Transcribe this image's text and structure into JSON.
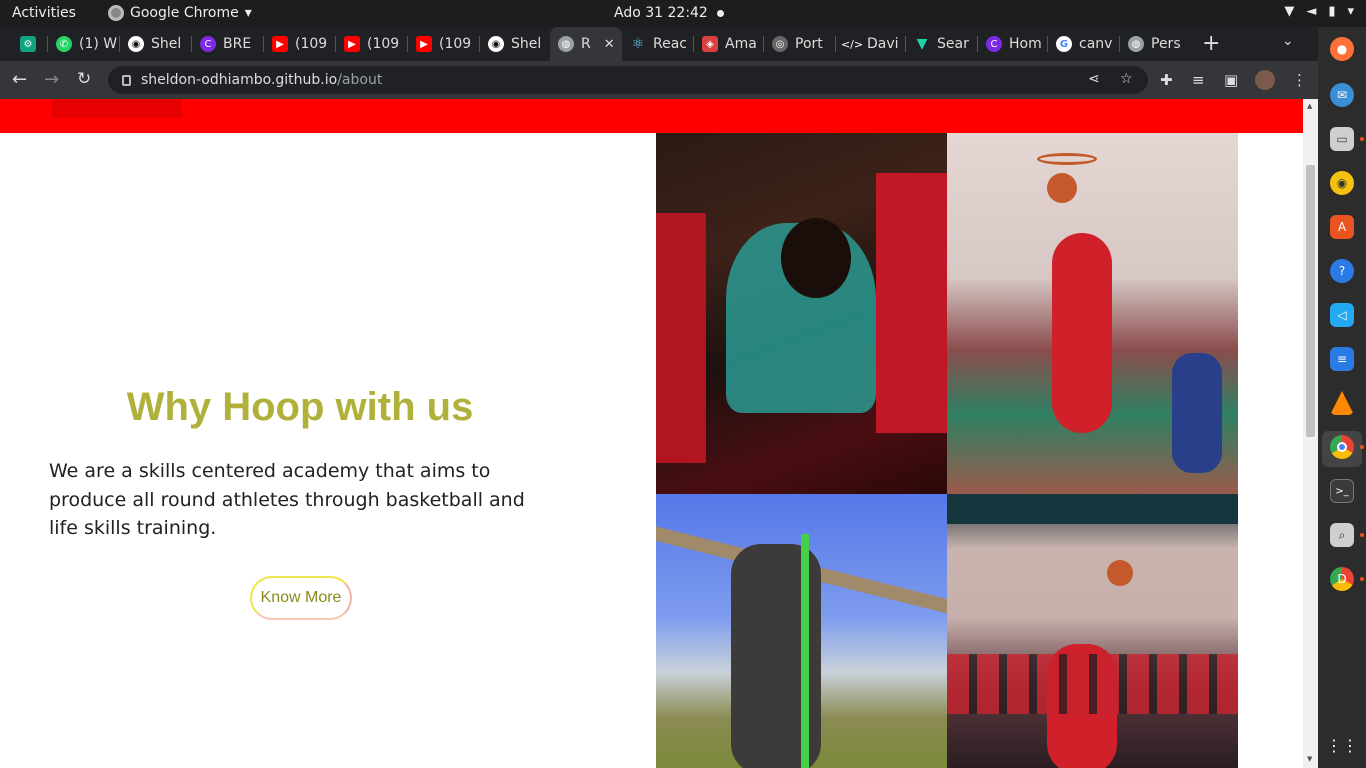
{
  "system": {
    "activities": "Activities",
    "app_name": "Google Chrome",
    "clock": "Ado 31  22:42"
  },
  "tabs": [
    {
      "label": "",
      "icon": "chatgpt-icon",
      "color": "#10a37f"
    },
    {
      "label": "(1) W",
      "icon": "whatsapp-icon",
      "color": "#25d366"
    },
    {
      "label": "Shel",
      "icon": "github-icon",
      "color": "#ffffff"
    },
    {
      "label": "BRE",
      "icon": "canva-icon",
      "color": "#7d2ae8"
    },
    {
      "label": "(109",
      "icon": "youtube-icon",
      "color": "#ff0000"
    },
    {
      "label": "(109",
      "icon": "youtube-icon",
      "color": "#ff0000"
    },
    {
      "label": "(109",
      "icon": "youtube-icon",
      "color": "#ff0000"
    },
    {
      "label": "Shel",
      "icon": "github-icon",
      "color": "#ffffff"
    },
    {
      "label": "R",
      "icon": "globe-icon",
      "color": "#9aa0a6",
      "active": true
    },
    {
      "label": "Reac",
      "icon": "react-icon",
      "color": "#61dafb"
    },
    {
      "label": "Ama",
      "icon": "cake-icon",
      "color": "#d94040"
    },
    {
      "label": "Port",
      "icon": "portfolio-icon",
      "color": "#bbbbbb"
    },
    {
      "label": "Davi",
      "icon": "code-icon",
      "color": "#ffffff"
    },
    {
      "label": "Sear",
      "icon": "vuetify-icon",
      "color": "#1dd3a7"
    },
    {
      "label": "Hom",
      "icon": "canva-icon",
      "color": "#7d2ae8"
    },
    {
      "label": "canv",
      "icon": "google-icon",
      "color": "#4285f4"
    },
    {
      "label": "Pers",
      "icon": "globe-icon",
      "color": "#9aa0a6"
    }
  ],
  "address": {
    "host": "sheldon-odhiambo.github.io",
    "path": "/about"
  },
  "page": {
    "heading": "Why Hoop with us",
    "description": "We are a skills centered academy that aims to produce all round athletes through basketball and life skills training.",
    "cta_label": "Know More",
    "accent_color": "#b0b13a",
    "band_color": "#ff0000"
  },
  "dock": [
    {
      "name": "firefox-icon",
      "color": "#ff7139"
    },
    {
      "name": "thunderbird-icon",
      "color": "#3a8fd6"
    },
    {
      "name": "files-icon",
      "color": "#cfcfcf"
    },
    {
      "name": "rhythmbox-icon",
      "color": "#f5c211"
    },
    {
      "name": "software-icon",
      "color": "#e95420"
    },
    {
      "name": "help-icon",
      "color": "#2a7be4"
    },
    {
      "name": "vscode-icon",
      "color": "#23a9f2"
    },
    {
      "name": "writer-icon",
      "color": "#2a7be4"
    },
    {
      "name": "vlc-icon",
      "color": "#ff8800"
    },
    {
      "name": "chrome-icon",
      "color": "#4285f4"
    },
    {
      "name": "terminal-icon",
      "color": "#3b3b3b"
    },
    {
      "name": "search-tool-icon",
      "color": "#cfcfcf"
    },
    {
      "name": "chrome-dev-icon",
      "color": "#34a853"
    },
    {
      "name": "app-grid-icon",
      "color": "#ffffff"
    }
  ]
}
